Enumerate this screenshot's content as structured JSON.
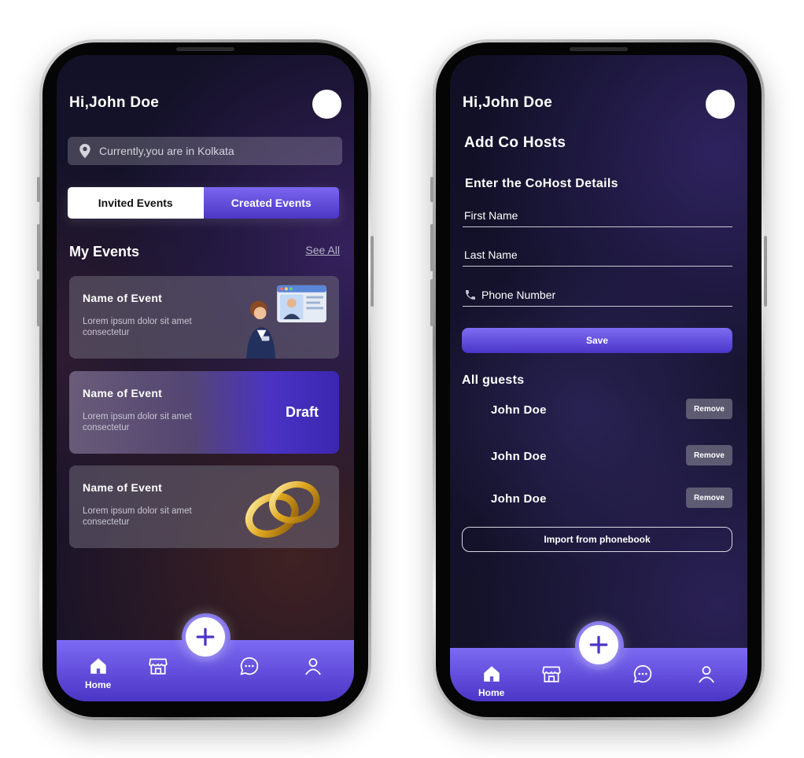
{
  "left_screen": {
    "greeting": "Hi,John Doe",
    "location_text": "Currently,you are in Kolkata",
    "tabs": [
      {
        "label": "Invited Events"
      },
      {
        "label": "Created Events"
      }
    ],
    "section_title": "My Events",
    "see_all": "See All",
    "events": [
      {
        "title": "Name of Event",
        "description": "Lorem ipsum dolor sit amet consectetur"
      },
      {
        "title": "Name of Event",
        "description": "Lorem ipsum dolor sit amet consectetur",
        "badge": "Draft"
      },
      {
        "title": "Name of Event",
        "description": "Lorem ipsum dolor sit amet consectetur"
      }
    ],
    "nav": {
      "home_label": "Home"
    }
  },
  "right_screen": {
    "greeting": "Hi,John Doe",
    "page_title": "Add Co Hosts",
    "form_title": "Enter the CoHost Details",
    "fields": {
      "first_name": "First Name",
      "last_name": "Last Name",
      "phone": "Phone Number"
    },
    "save_label": "Save",
    "guests_title": "All guests",
    "guests": [
      {
        "name": "John Doe",
        "action": "Remove"
      },
      {
        "name": "John Doe",
        "action": "Remove"
      },
      {
        "name": "John Doe",
        "action": "Remove"
      }
    ],
    "import_label": "Import from phonebook",
    "nav": {
      "home_label": "Home"
    }
  },
  "icons": [
    "location-pin-icon",
    "plus-icon",
    "home-icon",
    "store-icon",
    "chat-icon",
    "profile-icon",
    "phone-icon"
  ],
  "colors": {
    "accent": "#5b46d8",
    "background": "#15132b",
    "card": "#5e5868",
    "text": "#ffffff"
  }
}
